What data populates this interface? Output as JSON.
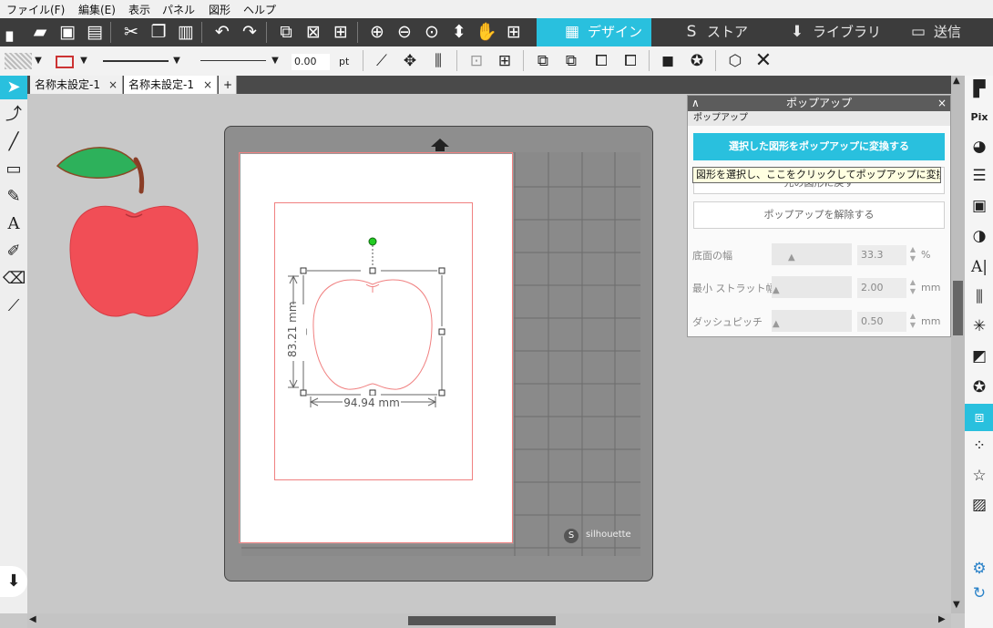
{
  "menu": [
    "ファイル(F)",
    "編集(E)",
    "表示",
    "パネル",
    "図形",
    "ヘルプ"
  ],
  "nav_tabs": [
    {
      "label": "デザイン",
      "icon": "grid-icon"
    },
    {
      "label": "ストア",
      "icon": "store-icon"
    },
    {
      "label": "ライブラリ",
      "icon": "library-icon"
    },
    {
      "label": "送信",
      "icon": "send-icon"
    }
  ],
  "toolbar2": {
    "line_width": "0.00",
    "unit": "pt"
  },
  "doc_tabs": [
    "名称未設定-1",
    "名称未設定-1"
  ],
  "popup_panel": {
    "title": "ポップアップ",
    "section": "ポップアップ",
    "convert_button": "選択した図形をポップアップに変換する",
    "restore_button": "元の図形に戻す",
    "release_button": "ポップアップを解除する",
    "tooltip": "図形を選択し、ここをクリックしてポップアップに変換します。",
    "base_width_label": "底面の幅",
    "base_width_value": "33.3",
    "base_width_unit": "%",
    "strut_width_label": "最小 ストラット幅",
    "strut_width_value": "2.00",
    "strut_width_unit": "mm",
    "dash_pitch_label": "ダッシュピッチ",
    "dash_pitch_value": "0.50",
    "dash_pitch_unit": "mm"
  },
  "dimensions": {
    "width": "94.94 mm",
    "height": "83.21 mm"
  },
  "mat": {
    "logo": "silhouette"
  },
  "colors": {
    "accent": "#29c0de",
    "apple_red": "#f14e56",
    "leaf_green": "#2db15b",
    "cut_line": "#f08080"
  }
}
